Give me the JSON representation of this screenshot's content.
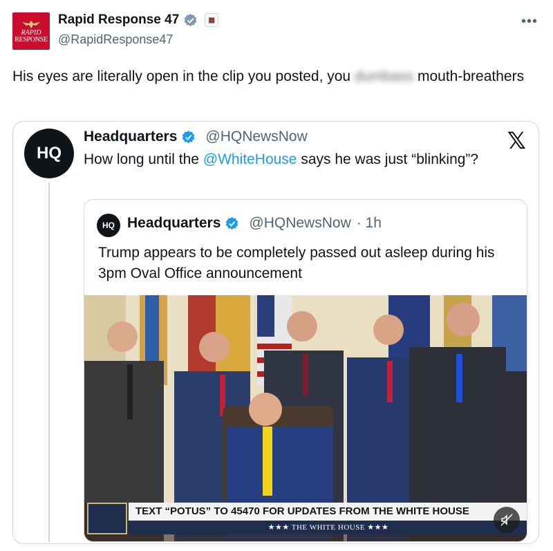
{
  "post": {
    "author_name": "Rapid Response 47",
    "author_handle": "@RapidResponse47",
    "avatar_line1": "RAPID",
    "avatar_line2": "RESPONSE",
    "more_label": "•••",
    "text_before": "His eyes are literally open in the clip you posted, you ",
    "text_blurred": "dumbass",
    "text_after": " mouth-breathers"
  },
  "quote": {
    "avatar_text": "HQ",
    "name": "Headquarters",
    "handle": "@HQNewsNow",
    "text_before": "How long until the ",
    "mention": "@WhiteHouse",
    "text_after": " says he was just “blinking”?",
    "x_logo": "𝕏"
  },
  "inner": {
    "avatar_text": "HQ",
    "name": "Headquarters",
    "handle": "@HQNewsNow",
    "time": "· 1h",
    "text": "Trump appears to be completely passed out asleep during his 3pm Oval Office announcement"
  },
  "media": {
    "banner_text": "TEXT “POTUS” TO 45470 FOR UPDATES FROM THE WHITE HOUSE",
    "banner_sub": "★★★  THE WHITE HOUSE  ★★★"
  },
  "colors": {
    "verified": "#1d9bf0",
    "mention": "#1d9bf0",
    "avatar_red": "#c8102e"
  },
  "icons": [
    "verified-badge-icon",
    "government-badge-icon",
    "more-icon",
    "x-logo-icon",
    "mute-icon"
  ]
}
